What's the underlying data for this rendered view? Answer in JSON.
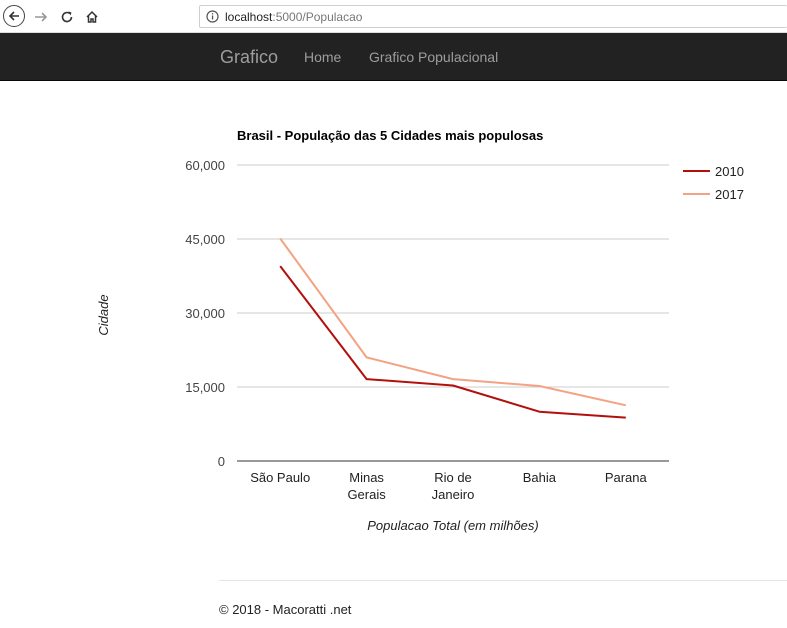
{
  "browser": {
    "url_host": "localhost",
    "url_path": ":5000/Populacao",
    "icons": [
      "back-arrow-icon",
      "forward-arrow-icon",
      "reload-icon",
      "home-icon",
      "info-icon"
    ]
  },
  "navbar": {
    "brand": "Grafico",
    "links": [
      "Home",
      "Grafico Populacional"
    ],
    "background": "#222222",
    "text_color": "#9d9d9d"
  },
  "chart_data": {
    "type": "line",
    "title": "Brasil - População das 5 Cidades mais populosas",
    "xlabel": "Populacao Total (em milhões)",
    "ylabel": "Cidade",
    "categories": [
      [
        "São Paulo"
      ],
      [
        "Minas",
        "Gerais"
      ],
      [
        "Rio de",
        "Janeiro"
      ],
      [
        "Bahia"
      ],
      [
        "Parana"
      ]
    ],
    "ylim": [
      0,
      60000
    ],
    "yticks": [
      "0",
      "15,000",
      "30,000",
      "45,000",
      "60,000"
    ],
    "ytick_values": [
      0,
      15000,
      30000,
      45000,
      60000
    ],
    "grid": true,
    "legend_position": "right",
    "series": [
      {
        "name": "2010",
        "color": "#b2100c",
        "values": [
          39500,
          16600,
          15300,
          10000,
          8800
        ]
      },
      {
        "name": "2017",
        "color": "#f4a283",
        "values": [
          45100,
          21000,
          16600,
          15200,
          11300
        ]
      }
    ]
  },
  "footer": {
    "text": "© 2018 - Macoratti .net"
  }
}
